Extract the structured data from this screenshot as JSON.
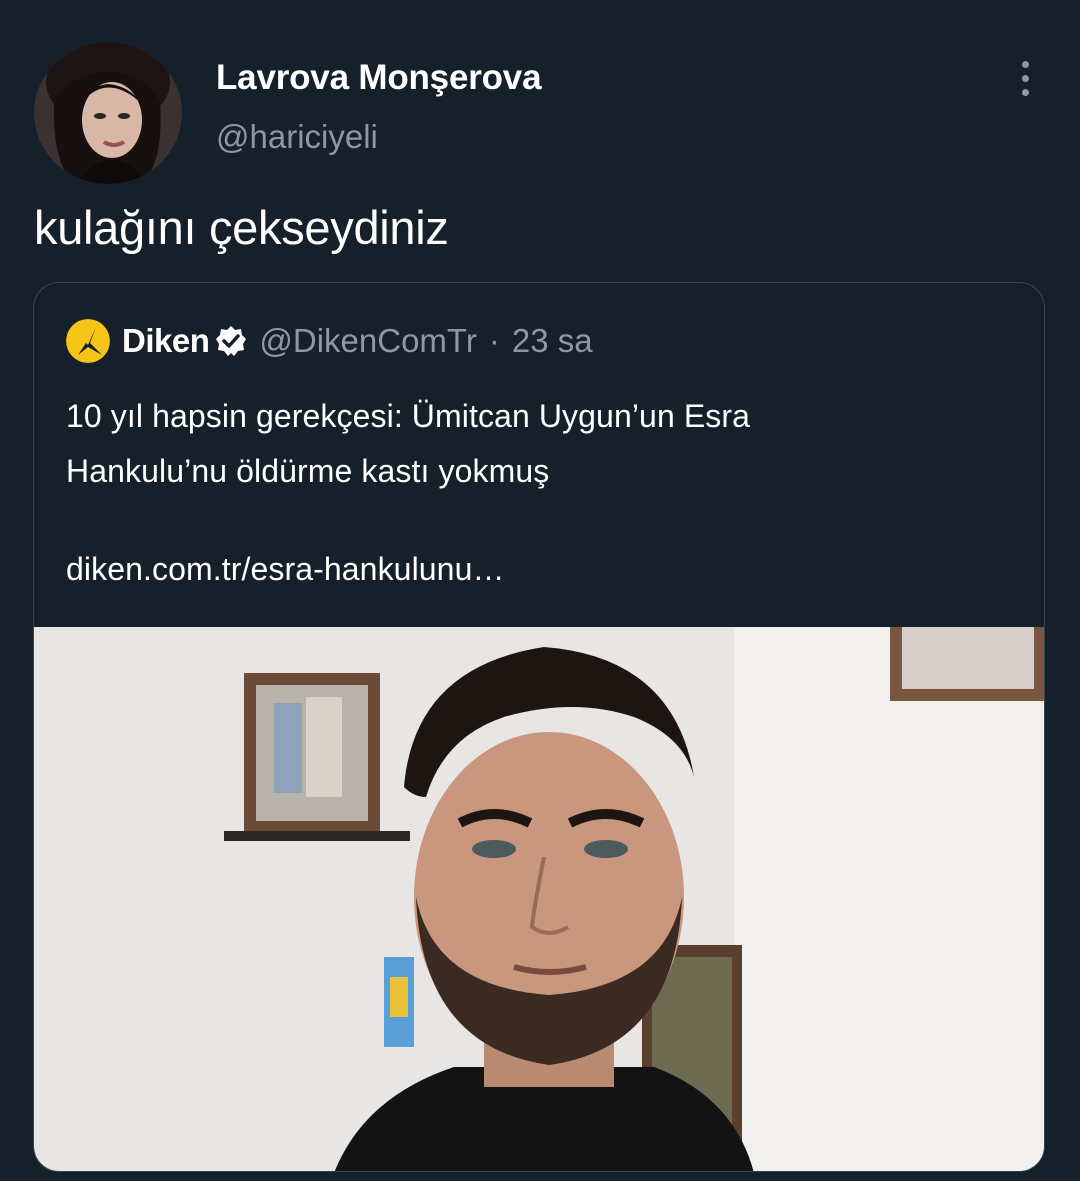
{
  "tweet": {
    "author_name": "Lavrova Monşerova",
    "author_handle": "@hariciyeli",
    "text": "kulağını çekseydiniz"
  },
  "quoted": {
    "author_name": "Diken",
    "author_handle": "@DikenComTr",
    "separator": "·",
    "time": "23 sa",
    "text_line1": "10 yıl hapsin gerekçesi: Ümitcan Uygun’un Esra",
    "text_line2": "Hankulu’nu öldürme kastı yokmuş",
    "link": "diken.com.tr/esra-hankulunu…"
  },
  "icons": {
    "more": "more-vertical-icon",
    "verified": "verified-badge-icon"
  },
  "colors": {
    "background": "#15202b",
    "muted_text": "#8b98a5",
    "border": "#38444d",
    "diken_yellow": "#f5c518"
  }
}
